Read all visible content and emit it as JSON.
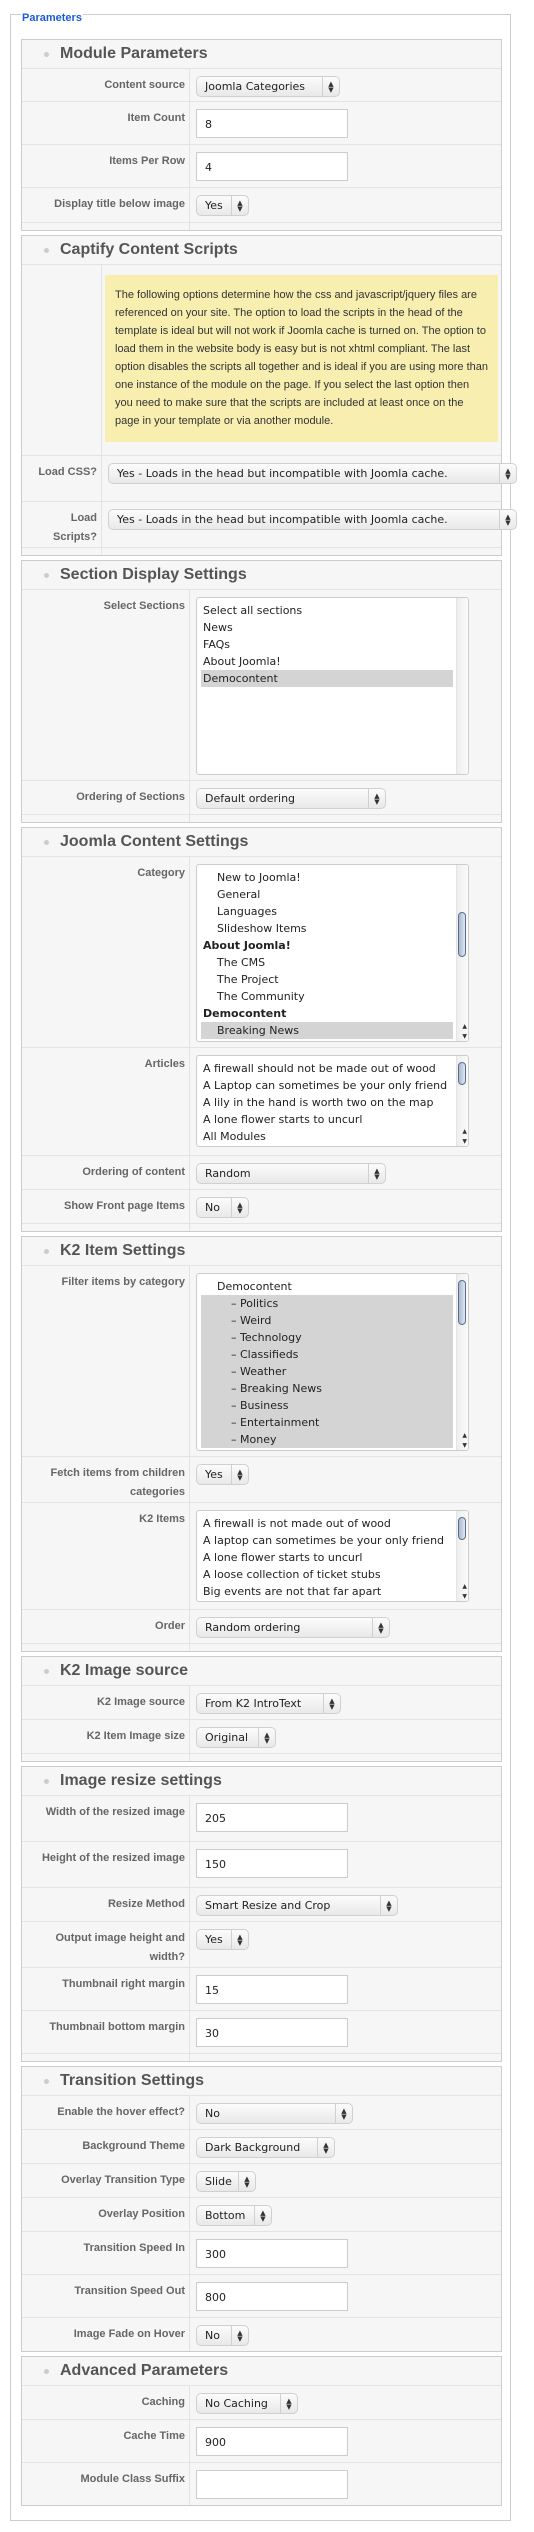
{
  "fieldset_legend": "Parameters",
  "sections": [
    {
      "title": "Module Parameters",
      "fields": [
        {
          "type": "select",
          "label": "Content source",
          "value": "Joomla Categories"
        },
        {
          "type": "text",
          "label": "Item Count",
          "value": "8"
        },
        {
          "type": "text",
          "label": "Items Per Row",
          "value": "4"
        },
        {
          "type": "select",
          "label": "Display title below image",
          "value": "Yes"
        }
      ]
    },
    {
      "title": "Captify Content Scripts",
      "fields": [
        {
          "type": "desc",
          "label": "",
          "value": "The following options determine how the css and javascript/jquery files are referenced on your site. The option to load the scripts in the head of the template is ideal but will not work if Joomla cache is turned on. The option to load them in the website body is easy but is not xhtml compliant. The last option disables the scripts all together and is ideal if you are using more than one instance of the module on the page. If you select the last option then you need to make sure that the scripts are included at least once on the page in your template or via another module."
        },
        {
          "type": "select",
          "label": "Load CSS?",
          "value": "Yes - Loads in the head but incompatible with Joomla cache."
        },
        {
          "type": "select",
          "label": "Load Scripts?",
          "value": "Yes - Loads in the head but incompatible with Joomla cache."
        }
      ]
    },
    {
      "title": "Section Display Settings",
      "fields": [
        {
          "type": "list",
          "label": "Select Sections",
          "scrollbar": false,
          "options": [
            {
              "text": "Select all sections"
            },
            {
              "text": "News"
            },
            {
              "text": "FAQs"
            },
            {
              "text": "About Joomla!"
            },
            {
              "text": "Democontent",
              "selected": true
            }
          ]
        },
        {
          "type": "select",
          "label": "Ordering of Sections",
          "value": "Default ordering"
        }
      ]
    },
    {
      "title": "Joomla Content Settings",
      "fields": [
        {
          "type": "list",
          "label": "Category",
          "scrollbar": true,
          "scroll_position": 0.3,
          "options": [
            {
              "text": "New to Joomla!",
              "indent": 1
            },
            {
              "text": "General",
              "indent": 1
            },
            {
              "text": "Languages",
              "indent": 1
            },
            {
              "text": "Slideshow Items",
              "indent": 1
            },
            {
              "text": "About Joomla!",
              "bold": true
            },
            {
              "text": "The CMS",
              "indent": 1
            },
            {
              "text": "The Project",
              "indent": 1
            },
            {
              "text": "The Community",
              "indent": 1
            },
            {
              "text": "Democontent",
              "bold": true
            },
            {
              "text": "Breaking News",
              "indent": 1,
              "selected": true
            }
          ]
        },
        {
          "type": "list",
          "label": "Articles",
          "scrollbar": true,
          "scroll_position": 0,
          "options": [
            {
              "text": "A firewall should not be made out of wood"
            },
            {
              "text": "A Laptop can sometimes be your only friend"
            },
            {
              "text": "A lily in the hand is worth two on the map"
            },
            {
              "text": "A lone flower starts to uncurl"
            },
            {
              "text": "All Modules"
            }
          ]
        },
        {
          "type": "select",
          "label": "Ordering of content",
          "value": "Random"
        },
        {
          "type": "select",
          "label": "Show Front page Items",
          "value": "No"
        }
      ]
    },
    {
      "title": "K2 Item Settings",
      "fields": [
        {
          "type": "list",
          "label": "Filter items by category",
          "scrollbar": true,
          "scroll_position": 0,
          "options": [
            {
              "text": "Democontent",
              "indent": 1
            },
            {
              "text": "– Politics",
              "indent": 2,
              "selected": true
            },
            {
              "text": "– Weird",
              "indent": 2,
              "selected": true
            },
            {
              "text": "– Technology",
              "indent": 2,
              "selected": true
            },
            {
              "text": "– Classifieds",
              "indent": 2,
              "selected": true
            },
            {
              "text": "– Weather",
              "indent": 2,
              "selected": true
            },
            {
              "text": "– Breaking News",
              "indent": 2,
              "selected": true
            },
            {
              "text": "– Business",
              "indent": 2,
              "selected": true
            },
            {
              "text": "– Entertainment",
              "indent": 2,
              "selected": true
            },
            {
              "text": "– Money",
              "indent": 2,
              "selected": true
            }
          ]
        },
        {
          "type": "select",
          "label": "Fetch items from children categories",
          "value": "Yes"
        },
        {
          "type": "list",
          "label": "K2 Items",
          "scrollbar": true,
          "scroll_position": 0,
          "options": [
            {
              "text": "A firewall is not made out of wood"
            },
            {
              "text": "A laptop can sometimes be your only friend"
            },
            {
              "text": "A lone flower starts to uncurl"
            },
            {
              "text": "A loose collection of ticket stubs"
            },
            {
              "text": "Big events are not that far apart"
            }
          ]
        },
        {
          "type": "select",
          "label": "Order",
          "value": "Random ordering"
        }
      ]
    },
    {
      "title": "K2 Image source",
      "fields": [
        {
          "type": "select",
          "label": "K2 Image source",
          "value": "From K2 IntroText"
        },
        {
          "type": "select",
          "label": "K2 Item Image size",
          "value": "Original"
        }
      ]
    },
    {
      "title": "Image resize settings",
      "fields": [
        {
          "type": "text",
          "label": "Width of the resized image",
          "value": "205"
        },
        {
          "type": "text",
          "label": "Height of the resized image",
          "value": "150"
        },
        {
          "type": "select",
          "label": "Resize Method",
          "value": "Smart Resize and Crop"
        },
        {
          "type": "select",
          "label": "Output image height and width?",
          "value": "Yes"
        },
        {
          "type": "text",
          "label": "Thumbnail right margin",
          "value": "15"
        },
        {
          "type": "text",
          "label": "Thumbnail bottom margin",
          "value": "30"
        }
      ]
    },
    {
      "title": "Transition Settings",
      "fields": [
        {
          "type": "select",
          "label": "Enable the hover effect?",
          "value": "No"
        },
        {
          "type": "select",
          "label": "Background Theme",
          "value": "Dark Background"
        },
        {
          "type": "select",
          "label": "Overlay Transition Type",
          "value": "Slide"
        },
        {
          "type": "select",
          "label": "Overlay Position",
          "value": "Bottom"
        },
        {
          "type": "text",
          "label": "Transition Speed In",
          "value": "300"
        },
        {
          "type": "text",
          "label": "Transition Speed Out",
          "value": "800"
        },
        {
          "type": "select",
          "label": "Image Fade on Hover",
          "value": "No"
        }
      ]
    },
    {
      "title": "Advanced Parameters",
      "fields": [
        {
          "type": "select",
          "label": "Caching",
          "value": "No Caching"
        },
        {
          "type": "text",
          "label": "Cache Time",
          "value": "900"
        },
        {
          "type": "text",
          "label": "Module Class Suffix",
          "value": ""
        }
      ]
    }
  ]
}
